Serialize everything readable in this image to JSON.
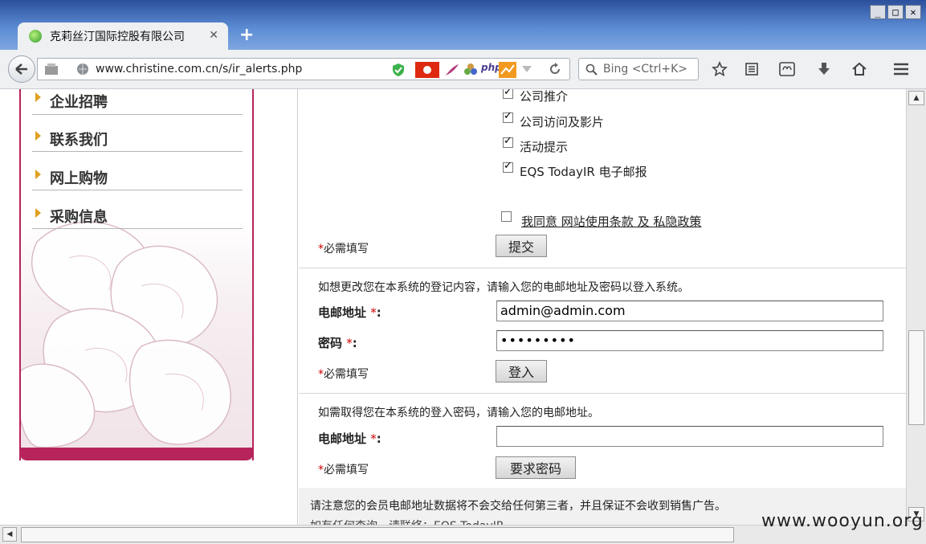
{
  "window": {
    "controls": {
      "minimize": "_",
      "maximize": "□",
      "close": "✕"
    }
  },
  "tab": {
    "title": "克莉丝汀国际控股有限公司",
    "close": "✕",
    "new_tab": "+"
  },
  "navbar": {
    "url": "www.christine.com.cn/s/ir_alerts.php",
    "search_placeholder": "Bing <Ctrl+K>",
    "php_badge": "php"
  },
  "sidebar": {
    "items": [
      {
        "label": "企业招聘"
      },
      {
        "label": "联系我们"
      },
      {
        "label": "网上购物"
      },
      {
        "label": "采购信息"
      }
    ]
  },
  "alerts": {
    "options": [
      {
        "label": "公司推介",
        "checked": true
      },
      {
        "label": "公司访问及影片",
        "checked": true
      },
      {
        "label": "活动提示",
        "checked": true
      },
      {
        "label": "EQS TodayIR 电子邮报",
        "checked": true
      }
    ],
    "agree": {
      "checked": false,
      "text": "我同意",
      "terms_link": "网站使用条款",
      "and": "及",
      "privacy_link": "私隐政策"
    },
    "required_note": "必需填写",
    "submit_label": "提交"
  },
  "login": {
    "intro": "如想更改您在本系统的登记内容，请输入您的电邮地址及密码以登入系统。",
    "email_label": "电邮地址",
    "email_value": "admin@admin.com",
    "password_label": "密码",
    "password_value": "•••••••••",
    "required_note": "必需填写",
    "login_label": "登入"
  },
  "forgot": {
    "intro": "如需取得您在本系统的登入密码，请输入您的电邮地址。",
    "email_label": "电邮地址",
    "email_value": "",
    "required_note": "必需填写",
    "button_label": "要求密码"
  },
  "notice": {
    "line1": "请注意您的会员电邮地址数据将不会交给任何第三者，并且保证不会收到销售广告。",
    "line2": "如有任何查询，请联络：EQS TodayIR"
  },
  "required_mark": "*",
  "watermark": "www.wooyun.org",
  "colors": {
    "accent": "#b7245b",
    "arrow": "#e0a020",
    "required": "#cc0000"
  }
}
